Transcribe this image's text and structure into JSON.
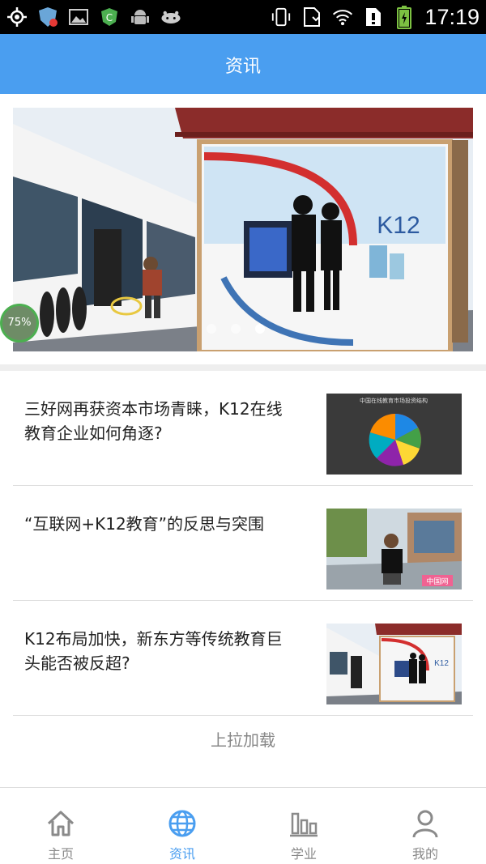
{
  "status_bar": {
    "time": "17:19",
    "left_icons": [
      "gps-icon",
      "shield-icon",
      "image-icon",
      "app-icon",
      "android-icon",
      "game-controller-icon"
    ],
    "right_icons": [
      "vibrate-icon",
      "sim-icon",
      "wifi-icon",
      "no-sim-icon",
      "battery-icon"
    ]
  },
  "header": {
    "title": "资讯"
  },
  "banner": {
    "sign_text": "K12",
    "progress_badge": "75%",
    "dots_count": 3,
    "active_dot": 2
  },
  "news": [
    {
      "title": "三好网再获资本市场青睐，K12在线教育企业如何角逐?",
      "thumb_caption": "中国在线教育市场投资结构"
    },
    {
      "title": "“互联网+K12教育”的反思与突围",
      "thumb_caption": "中国网"
    },
    {
      "title": "K12布局加快，新东方等传统教育巨头能否被反超?",
      "thumb_caption": "K12"
    }
  ],
  "load_more": "上拉加载",
  "bottom_nav": [
    {
      "label": "主页",
      "icon": "home-icon",
      "active": false
    },
    {
      "label": "资讯",
      "icon": "globe-icon",
      "active": true
    },
    {
      "label": "学业",
      "icon": "bar-chart-icon",
      "active": false
    },
    {
      "label": "我的",
      "icon": "person-icon",
      "active": false
    }
  ],
  "colors": {
    "accent": "#4a9ef0",
    "status_bar": "#000000",
    "badge": "#4caf50"
  }
}
